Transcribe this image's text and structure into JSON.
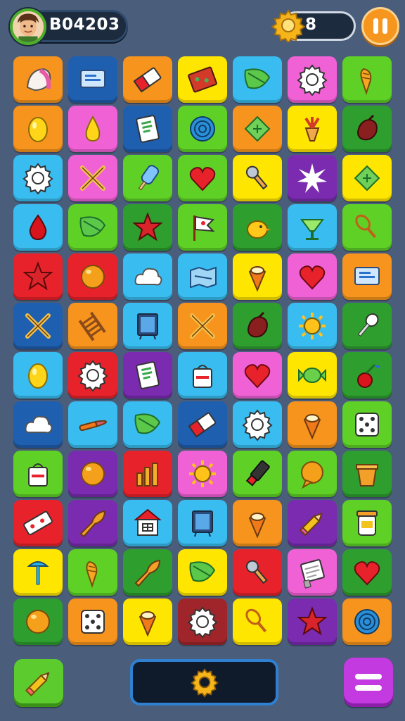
{
  "header": {
    "player_id": "B04203",
    "coins": "8"
  },
  "board": {
    "columns": 7,
    "rows": 12,
    "tiles": [
      [
        {
          "color": "#f7941d",
          "icon": "shell-icon"
        },
        {
          "color": "#1f5fb0",
          "icon": "screen-icon"
        },
        {
          "color": "#f7941d",
          "icon": "eraser-icon"
        },
        {
          "color": "#ffe600",
          "icon": "book-icon"
        },
        {
          "color": "#39bdf0",
          "icon": "leaf-icon"
        },
        {
          "color": "#f061d6",
          "icon": "gear-icon"
        },
        {
          "color": "#5fd126",
          "icon": "carrot-icon"
        }
      ],
      [
        {
          "color": "#f7941d",
          "icon": "lemon-icon"
        },
        {
          "color": "#f061d6",
          "icon": "pear-icon"
        },
        {
          "color": "#1f5fb0",
          "icon": "card-icon"
        },
        {
          "color": "#5fd126",
          "icon": "spiral-icon"
        },
        {
          "color": "#f7941d",
          "icon": "diamond-icon"
        },
        {
          "color": "#ffe600",
          "icon": "plant-icon"
        },
        {
          "color": "#2e9e2e",
          "icon": "seed-icon"
        }
      ],
      [
        {
          "color": "#39bdf0",
          "icon": "gear-icon"
        },
        {
          "color": "#f061d6",
          "icon": "cross-icon"
        },
        {
          "color": "#5fd126",
          "icon": "popsicle-icon"
        },
        {
          "color": "#5fd126",
          "icon": "heart-icon"
        },
        {
          "color": "#ffe600",
          "icon": "key-icon"
        },
        {
          "color": "#7a2bb0",
          "icon": "star-burst-icon"
        },
        {
          "color": "#ffe600",
          "icon": "diamond-icon"
        }
      ],
      [
        {
          "color": "#39bdf0",
          "icon": "drop-icon"
        },
        {
          "color": "#5fd126",
          "icon": "leaf-icon"
        },
        {
          "color": "#2e9e2e",
          "icon": "star-icon"
        },
        {
          "color": "#5fd126",
          "icon": "flag-icon"
        },
        {
          "color": "#2e9e2e",
          "icon": "bird-icon"
        },
        {
          "color": "#39bdf0",
          "icon": "cup-icon"
        },
        {
          "color": "#5fd126",
          "icon": "racket-icon"
        }
      ],
      [
        {
          "color": "#e8222a",
          "icon": "star-icon"
        },
        {
          "color": "#e8222a",
          "icon": "ball-icon"
        },
        {
          "color": "#39bdf0",
          "icon": "cloud-icon"
        },
        {
          "color": "#39bdf0",
          "icon": "map-icon"
        },
        {
          "color": "#ffe600",
          "icon": "cone-icon"
        },
        {
          "color": "#f061d6",
          "icon": "heart-icon"
        },
        {
          "color": "#f7941d",
          "icon": "screen-icon"
        }
      ],
      [
        {
          "color": "#1f5fb0",
          "icon": "cross-icon"
        },
        {
          "color": "#f7941d",
          "icon": "ladder-icon"
        },
        {
          "color": "#39bdf0",
          "icon": "board-icon"
        },
        {
          "color": "#f7941d",
          "icon": "cross-icon"
        },
        {
          "color": "#2e9e2e",
          "icon": "seed-icon"
        },
        {
          "color": "#39bdf0",
          "icon": "sun-icon"
        },
        {
          "color": "#2e9e2e",
          "icon": "spoon-icon"
        }
      ],
      [
        {
          "color": "#39bdf0",
          "icon": "lemon-icon"
        },
        {
          "color": "#e8222a",
          "icon": "gear-icon"
        },
        {
          "color": "#7a2bb0",
          "icon": "card-icon"
        },
        {
          "color": "#39bdf0",
          "icon": "bag-icon"
        },
        {
          "color": "#f061d6",
          "icon": "heart-icon"
        },
        {
          "color": "#ffe600",
          "icon": "candy-icon"
        },
        {
          "color": "#2e9e2e",
          "icon": "cherry-icon"
        }
      ],
      [
        {
          "color": "#1f5fb0",
          "icon": "cloud-icon"
        },
        {
          "color": "#39bdf0",
          "icon": "brush-icon"
        },
        {
          "color": "#39bdf0",
          "icon": "leaf-icon"
        },
        {
          "color": "#1f5fb0",
          "icon": "eraser-icon"
        },
        {
          "color": "#39bdf0",
          "icon": "gear-icon"
        },
        {
          "color": "#f7941d",
          "icon": "cone-icon"
        },
        {
          "color": "#5fd126",
          "icon": "dice-icon"
        }
      ],
      [
        {
          "color": "#5fd126",
          "icon": "bag-icon"
        },
        {
          "color": "#7a2bb0",
          "icon": "ball-icon"
        },
        {
          "color": "#e8222a",
          "icon": "chart-icon"
        },
        {
          "color": "#f061d6",
          "icon": "sun-icon"
        },
        {
          "color": "#5fd126",
          "icon": "marker-icon"
        },
        {
          "color": "#5fd126",
          "icon": "bubble-icon"
        },
        {
          "color": "#2e9e2e",
          "icon": "box-icon"
        }
      ],
      [
        {
          "color": "#e8222a",
          "icon": "ticket-icon"
        },
        {
          "color": "#7a2bb0",
          "icon": "trumpet-icon"
        },
        {
          "color": "#39bdf0",
          "icon": "house-icon"
        },
        {
          "color": "#39bdf0",
          "icon": "board-icon"
        },
        {
          "color": "#f7941d",
          "icon": "cone-icon"
        },
        {
          "color": "#7a2bb0",
          "icon": "pencil-icon"
        },
        {
          "color": "#5fd126",
          "icon": "jar-icon"
        }
      ],
      [
        {
          "color": "#ffe600",
          "icon": "pin-icon"
        },
        {
          "color": "#5fd126",
          "icon": "carrot-icon"
        },
        {
          "color": "#2e9e2e",
          "icon": "trumpet-icon"
        },
        {
          "color": "#ffe600",
          "icon": "leaf-icon"
        },
        {
          "color": "#e8222a",
          "icon": "key-icon"
        },
        {
          "color": "#f061d6",
          "icon": "note-icon"
        },
        {
          "color": "#2e9e2e",
          "icon": "heart-icon"
        }
      ],
      [
        {
          "color": "#2e9e2e",
          "icon": "ball-icon"
        },
        {
          "color": "#f7941d",
          "icon": "dice-icon"
        },
        {
          "color": "#ffe600",
          "icon": "cone-icon"
        },
        {
          "color": "#a0252a",
          "icon": "gear-icon"
        },
        {
          "color": "#ffe600",
          "icon": "racket-icon"
        },
        {
          "color": "#7a2bb0",
          "icon": "star-icon"
        },
        {
          "color": "#f7941d",
          "icon": "spiral-icon"
        }
      ]
    ]
  },
  "footer": {
    "left_icon": "pencil-icon",
    "center_icon": "gear-icon",
    "right_icon": "menu-icon"
  }
}
